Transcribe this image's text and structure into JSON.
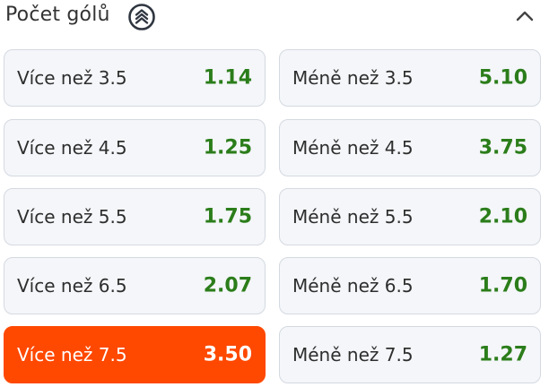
{
  "market": {
    "title": "Počet gólů"
  },
  "odds": {
    "over": [
      {
        "label": "Více než 3.5",
        "value": "1.14"
      },
      {
        "label": "Více než 4.5",
        "value": "1.25"
      },
      {
        "label": "Více než 5.5",
        "value": "1.75"
      },
      {
        "label": "Více než 6.5",
        "value": "2.07"
      },
      {
        "label": "Více než 7.5",
        "value": "3.50"
      }
    ],
    "under": [
      {
        "label": "Méně než 3.5",
        "value": "5.10"
      },
      {
        "label": "Méně než 4.5",
        "value": "3.75"
      },
      {
        "label": "Méně než 5.5",
        "value": "2.10"
      },
      {
        "label": "Méně než 6.5",
        "value": "1.70"
      },
      {
        "label": "Méně než 7.5",
        "value": "1.27"
      }
    ],
    "selected": "Více než 7.5"
  },
  "colors": {
    "odds_value": "#2b7d1a",
    "selected_bg": "#ff4800",
    "button_bg": "#f4f6f9"
  },
  "icons": {
    "header_badge": "chevrons-up-circle-icon",
    "collapse": "chevron-up-icon"
  }
}
